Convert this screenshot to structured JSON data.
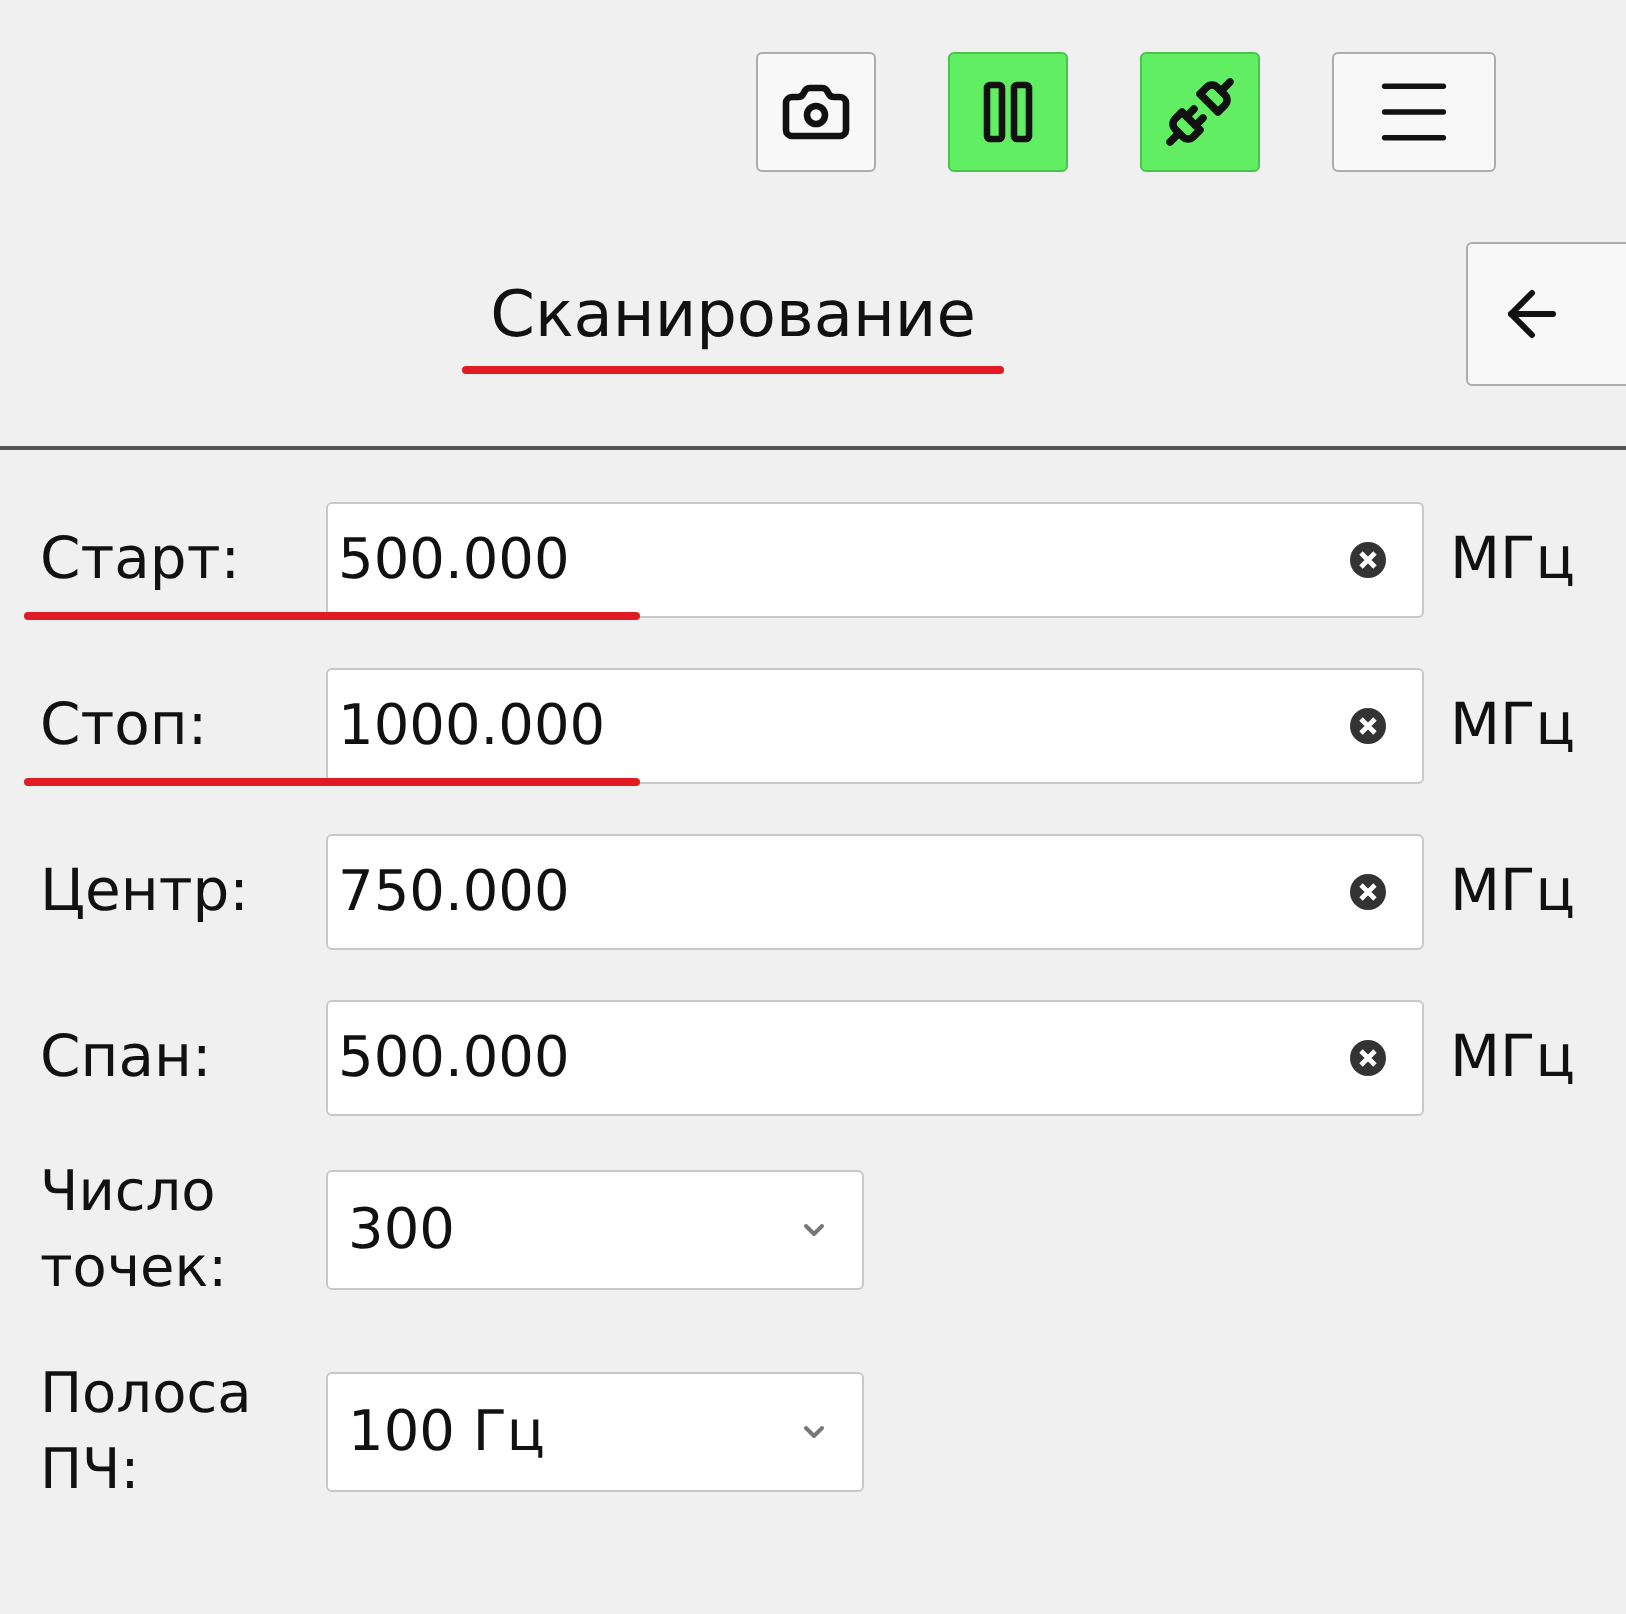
{
  "toolbar": [
    {
      "kind": "camera",
      "active": false
    },
    {
      "kind": "pause",
      "active": true
    },
    {
      "kind": "connect",
      "active": true
    },
    {
      "kind": "menu",
      "active": false
    }
  ],
  "header": {
    "title": "Сканирование",
    "underlined": true
  },
  "fields": [
    {
      "label": "Старт:",
      "value": "500.000",
      "unit": "МГц",
      "underlined": true
    },
    {
      "label": "Стоп:",
      "value": "1000.000",
      "unit": "МГц",
      "underlined": true
    },
    {
      "label": "Центр:",
      "value": "750.000",
      "unit": "МГц",
      "underlined": false
    },
    {
      "label": "Спан:",
      "value": "500.000",
      "unit": "МГц",
      "underlined": false
    }
  ],
  "selects": [
    {
      "label": "Число точек:",
      "value": "300"
    },
    {
      "label": "Полоса ПЧ:",
      "value": "100 Гц"
    }
  ]
}
